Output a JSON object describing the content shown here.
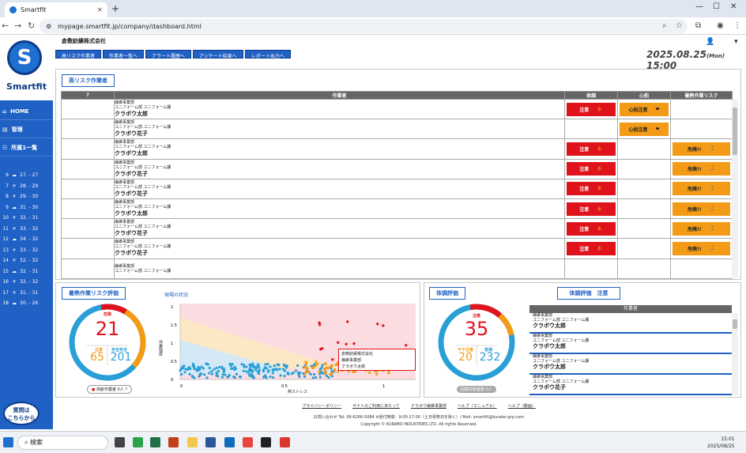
{
  "browser": {
    "tab_title": "Smartfit",
    "url": "mypage.smartfit.jp/company/dashboard.html"
  },
  "brand": {
    "logo_text": "Smartfit"
  },
  "sidebar": {
    "items": [
      {
        "label": "HOME"
      },
      {
        "label": "管理"
      },
      {
        "label": "所属1一覧"
      }
    ],
    "weather": [
      {
        "d": "6",
        "t": "27. - 27"
      },
      {
        "d": "7",
        "t": "28. - 29"
      },
      {
        "d": "8",
        "t": "29. - 30"
      },
      {
        "d": "9",
        "t": "31. - 30"
      },
      {
        "d": "10",
        "t": "32. - 31"
      },
      {
        "d": "11",
        "t": "33. - 32"
      },
      {
        "d": "12",
        "t": "34. - 32"
      },
      {
        "d": "13",
        "t": "33. - 32"
      },
      {
        "d": "14",
        "t": "32. - 32"
      },
      {
        "d": "15",
        "t": "32. - 31"
      },
      {
        "d": "16",
        "t": "32. - 32"
      },
      {
        "d": "17",
        "t": "31. - 31"
      },
      {
        "d": "18",
        "t": "30. - 26"
      }
    ],
    "chat_label1": "質問は",
    "chat_label2": "こちらから"
  },
  "header": {
    "company": "倉敷紡績株式会社",
    "buttons": [
      "高リスク作業者",
      "作業者一覧へ",
      "アラート履歴へ",
      "アンケート結果へ",
      "レポート出力へ"
    ],
    "date": "2025.08.25",
    "weekday": "(Mon)",
    "time": "15:00"
  },
  "risk": {
    "title": "高リスク作業者",
    "columns": [
      "?",
      "作業者",
      "体調",
      "心拍",
      "暑熱作業リスク"
    ],
    "rows": [
      {
        "dept1": "繊維事業部",
        "dept2": "ユニフォーム部 ユニフォーム課",
        "name": "クラボウ太郎",
        "health": "注意",
        "heart": "心拍注意",
        "heat": ""
      },
      {
        "dept1": "繊維事業部",
        "dept2": "ユニフォーム部 ユニフォーム課",
        "name": "クラボウ花子",
        "health": "",
        "heart": "心拍注意",
        "heat": ""
      },
      {
        "dept1": "繊維事業部",
        "dept2": "ユニフォーム部 ユニフォーム課",
        "name": "クラボウ太郎",
        "health": "注意",
        "heart": "",
        "heat": "危険!!"
      },
      {
        "dept1": "繊維事業部",
        "dept2": "ユニフォーム部 ユニフォーム課",
        "name": "クラボウ花子",
        "health": "注意",
        "heart": "",
        "heat": "危険!!"
      },
      {
        "dept1": "繊維事業部",
        "dept2": "ユニフォーム部 ユニフォーム課",
        "name": "クラボウ花子",
        "health": "注意",
        "heart": "",
        "heat": "危険!!"
      },
      {
        "dept1": "繊維事業部",
        "dept2": "ユニフォーム部 ユニフォーム課",
        "name": "クラボウ太郎",
        "health": "注意",
        "heart": "",
        "heat": "危険!!"
      },
      {
        "dept1": "繊維事業部",
        "dept2": "ユニフォーム部 ユニフォーム課",
        "name": "クラボウ花子",
        "health": "注意",
        "heart": "",
        "heat": "危険!!"
      },
      {
        "dept1": "繊維事業部",
        "dept2": "ユニフォーム部 ユニフォーム課",
        "name": "クラボウ花子",
        "health": "注意",
        "heart": "",
        "heat": "危険!!"
      },
      {
        "dept1": "繊維事業部",
        "dept2": "ユニフォーム部 ユニフォーム課",
        "name": "",
        "health": "",
        "heart": "",
        "heat": ""
      }
    ]
  },
  "heat_panel": {
    "title": "暑熱作業リスク評価",
    "danger_label": "危険",
    "danger_value": "21",
    "caution_label": "注意",
    "caution_value": "65",
    "safe_label": "安全安全",
    "safe_value": "201",
    "unit": "人",
    "note": "高齢作業者 0人"
  },
  "scatter": {
    "title": "現場の状況",
    "xlabel": "熱ストレス",
    "ylabel": "作業強度",
    "x_ticks": [
      "0",
      "0.5",
      "1"
    ],
    "y_ticks": [
      "0",
      "0.5",
      "1",
      "1.5",
      "2"
    ],
    "tooltip": [
      "倉敷紡績株式会社",
      "繊維事業部",
      "クラボウ太郎"
    ]
  },
  "health_panel": {
    "title": "体調評価",
    "danger_label": "注意",
    "danger_value": "35",
    "caution_label": "やや注意",
    "caution_value": "20",
    "safe_label": "普通",
    "safe_value": "232",
    "unit": "人",
    "note": "回答対象者数 0人",
    "list_title": "体調評価　注意",
    "list_header": "作業者",
    "rows": [
      {
        "dept1": "繊維事業部",
        "dept2": "ユニフォーム部 ユニフォーム課",
        "name": "クラボウ太郎"
      },
      {
        "dept1": "繊維事業部",
        "dept2": "ユニフォーム部 ユニフォーム課",
        "name": "クラボウ太郎"
      },
      {
        "dept1": "繊維事業部",
        "dept2": "ユニフォーム部 ユニフォーム課",
        "name": "クラボウ太郎"
      },
      {
        "dept1": "繊維事業部",
        "dept2": "ユニフォーム部 ユニフォーム課",
        "name": "クラボウ花子"
      }
    ]
  },
  "footer": {
    "links": [
      "プライバシーポリシー",
      "サイトのご利用にあたって",
      "クラボウ繊維事業部",
      "ヘルプ（マニュアル）",
      "ヘルプ（動画）"
    ],
    "contact": "お問い合わせ Tel: 06-6266-5084 ※受付時間：9:00-17:00（土日祝祭日を除く）/ Mail: smartfit@kurabo-grp.com",
    "copyright": "Copyright © KURABO INDUSTRIES LTD. All rights Reserved."
  },
  "taskbar": {
    "search": "検索",
    "time": "15:01",
    "date": "2025/08/25"
  },
  "colors": {
    "primary": "#1f61c4",
    "danger": "#e0121b",
    "caution": "#f39b16",
    "safe": "#2a9fd6"
  }
}
